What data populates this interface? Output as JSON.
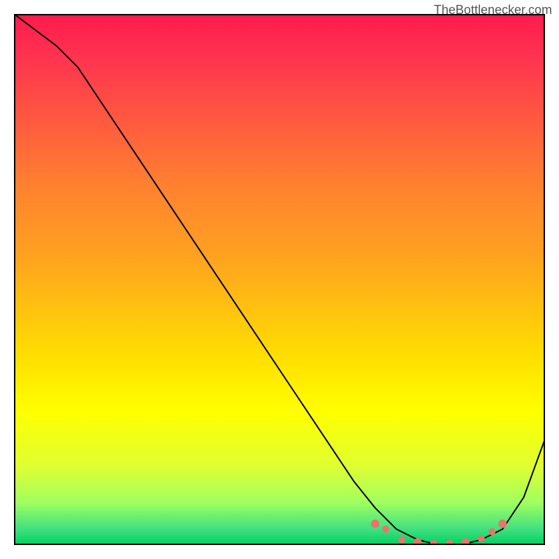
{
  "watermark": "TheBottlenecker.com",
  "chart_data": {
    "type": "line",
    "title": "",
    "xlabel": "",
    "ylabel": "",
    "xlim": [
      0,
      100
    ],
    "ylim": [
      0,
      100
    ],
    "series": [
      {
        "name": "bottleneck-curve",
        "x": [
          0,
          4,
          8,
          12,
          16,
          20,
          24,
          28,
          32,
          36,
          40,
          44,
          48,
          52,
          56,
          60,
          64,
          68,
          72,
          76,
          80,
          84,
          88,
          92,
          96,
          100
        ],
        "y": [
          100,
          97,
          94,
          90,
          84,
          78,
          72,
          66,
          60,
          54,
          48,
          42,
          36,
          30,
          24,
          18,
          12,
          7,
          3,
          1,
          0,
          0,
          1,
          3,
          9,
          20
        ]
      }
    ],
    "markers": {
      "name": "highlight-points",
      "x": [
        68,
        70,
        73,
        76,
        79,
        82,
        85,
        88,
        90,
        92
      ],
      "y": [
        4,
        3,
        1,
        0.5,
        0.3,
        0.3,
        0.5,
        1.2,
        2.5,
        4
      ]
    },
    "background": {
      "type": "vertical-gradient",
      "stops": [
        {
          "pos": 0,
          "color": "#ff1a4d"
        },
        {
          "pos": 50,
          "color": "#ffc010"
        },
        {
          "pos": 80,
          "color": "#ffff00"
        },
        {
          "pos": 100,
          "color": "#00d060"
        }
      ]
    }
  }
}
